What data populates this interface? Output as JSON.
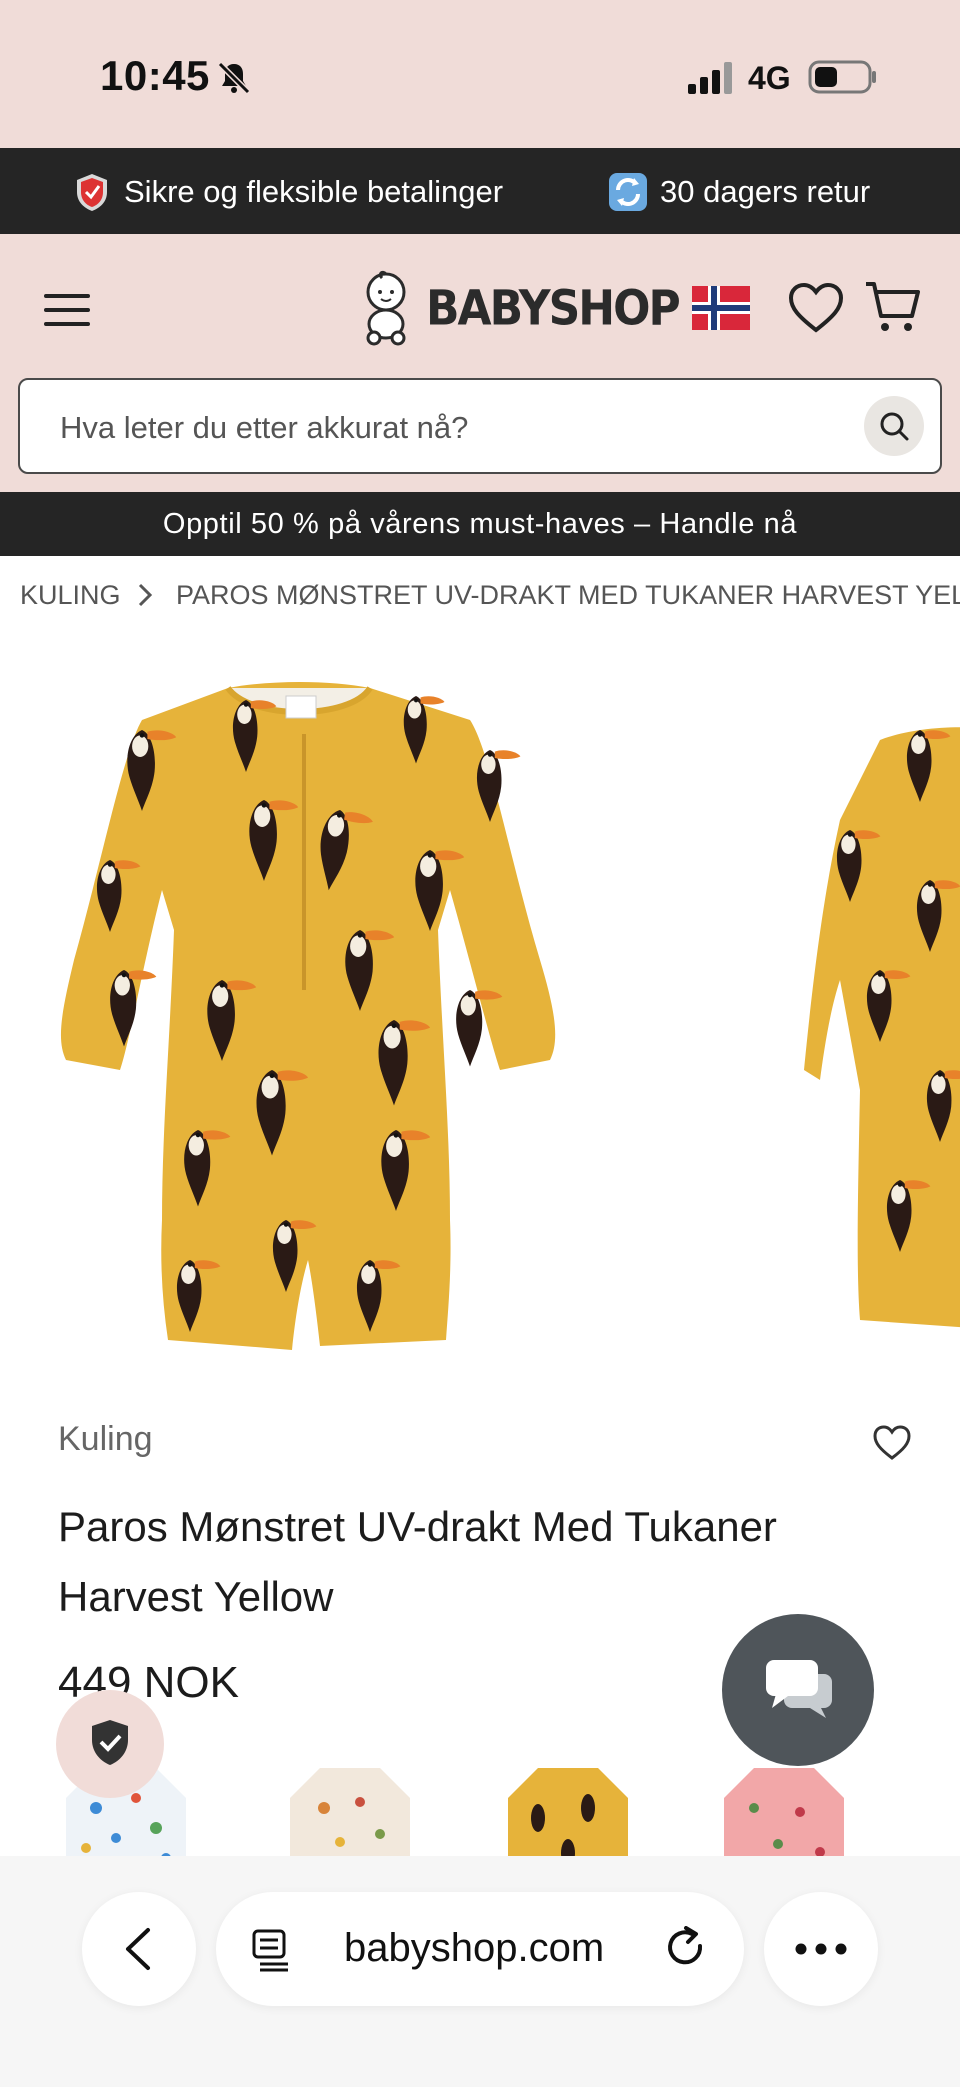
{
  "status_bar": {
    "time": "10:45",
    "network": "4G"
  },
  "trust_bar": {
    "item1": "Sikre og fleksible betalinger",
    "item2": "30 dagers retur"
  },
  "header": {
    "logo_text": "BABYSHOP",
    "search_placeholder": "Hva leter du etter akkurat nå?"
  },
  "promo": {
    "text": "Opptil 50 % på vårens must-haves – Handle nå"
  },
  "breadcrumb": {
    "items": [
      "KULING",
      "PAROS MØNSTRET UV-DRAKT MED TUKANER HARVEST YELLOW"
    ]
  },
  "product": {
    "brand": "Kuling",
    "title": "Paros Mønstret UV-drakt Med Tukaner Harvest Yellow",
    "price": "449 NOK",
    "variants": [
      "blue-white print",
      "cream fruit print",
      "yellow toucan print",
      "pink print"
    ]
  },
  "browser": {
    "url": "babyshop.com"
  },
  "colors": {
    "header_bg": "#f0dcd8",
    "dark_bar": "#252525",
    "garment_yellow": "#e6b33a",
    "chat_bubble": "#4f555a"
  },
  "icons": [
    "bell-slash-icon",
    "signal-icon",
    "battery-icon",
    "shield-icon",
    "return-icon",
    "menu-icon",
    "flag-norway-icon",
    "heart-icon",
    "cart-icon",
    "search-icon",
    "chevron-right-icon",
    "chat-icon",
    "verified-shield-icon",
    "chevron-left-icon",
    "page-icon",
    "reload-icon",
    "more-icon"
  ]
}
